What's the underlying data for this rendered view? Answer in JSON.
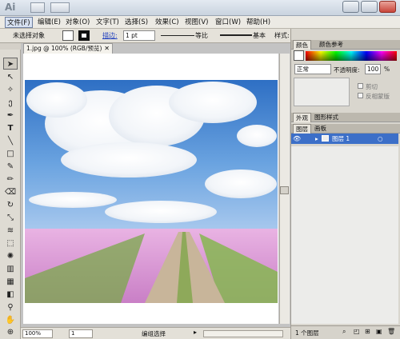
{
  "titlebar": {
    "app_logo": "Ai",
    "buttons": [
      "window-min",
      "window-max",
      "window-close"
    ]
  },
  "menu": [
    "文件(F)",
    "编辑(E)",
    "对象(O)",
    "文字(T)",
    "选择(S)",
    "效果(C)",
    "视图(V)",
    "窗口(W)",
    "帮助(H)"
  ],
  "controlbar": {
    "selection_label": "未选择对象",
    "stroke_label": "描边:",
    "stroke_weight": "1 pt",
    "profile": "等比",
    "brush": "基本",
    "style_label": "样式:"
  },
  "document": {
    "tab_title": "1.jpg @ 100% (RGB/预览)",
    "zoom": "100%",
    "page": "1",
    "status_text": "编组选择"
  },
  "panels": {
    "color_tabs": [
      "颜色",
      "颜色参考"
    ],
    "transparency_mode": "正常",
    "opacity_label": "不透明度:",
    "opacity_value": "100",
    "opacity_unit": "%",
    "clip_label": "剪切",
    "invert_label": "反相蒙版",
    "appearance_tabs": [
      "外观",
      "图形样式"
    ],
    "layers_tabs": [
      "图层",
      "画板"
    ],
    "layer_name": "图层 1",
    "layers_count": "1 个图层"
  },
  "colors": {
    "accent": "#3c6fc8",
    "sky": "#4a86d4",
    "field": "#e1a2d8"
  }
}
